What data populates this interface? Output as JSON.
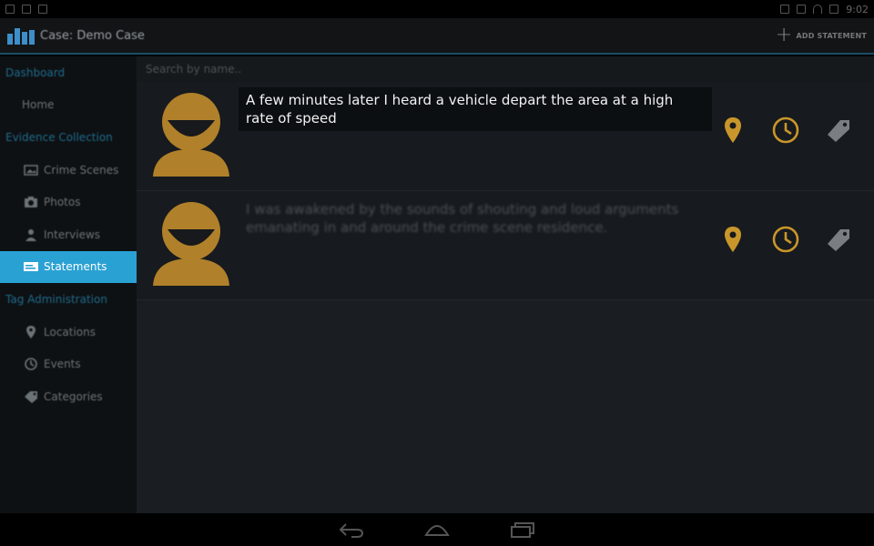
{
  "status_bar": {
    "time": "9:02"
  },
  "action_bar": {
    "title": "Case: Demo Case",
    "add_label": "ADD STATEMENT"
  },
  "sidebar": {
    "sections": [
      {
        "heading": "Dashboard",
        "items": [
          {
            "label": "Home",
            "icon": ""
          }
        ]
      },
      {
        "heading": "Evidence Collection",
        "items": [
          {
            "label": "Crime Scenes",
            "icon": "image-icon"
          },
          {
            "label": "Photos",
            "icon": "camera-icon"
          },
          {
            "label": "Interviews",
            "icon": "person-icon"
          },
          {
            "label": "Statements",
            "icon": "statement-icon",
            "active": true
          }
        ]
      },
      {
        "heading": "Tag Administration",
        "items": [
          {
            "label": "Locations",
            "icon": "location-pin-icon"
          },
          {
            "label": "Events",
            "icon": "clock-icon"
          },
          {
            "label": "Categories",
            "icon": "tag-icon"
          }
        ]
      }
    ]
  },
  "search": {
    "placeholder": "Search by name.."
  },
  "statements": [
    {
      "text": "A few minutes later I heard a vehicle depart the area at a high rate of speed"
    },
    {
      "text": "I was awakened by the sounds of shouting and loud arguments emanating in and around the crime scene residence."
    }
  ],
  "colors": {
    "accent": "#2aa1d3",
    "avatar": "#b0802a",
    "icon_gold": "#c8962a"
  }
}
